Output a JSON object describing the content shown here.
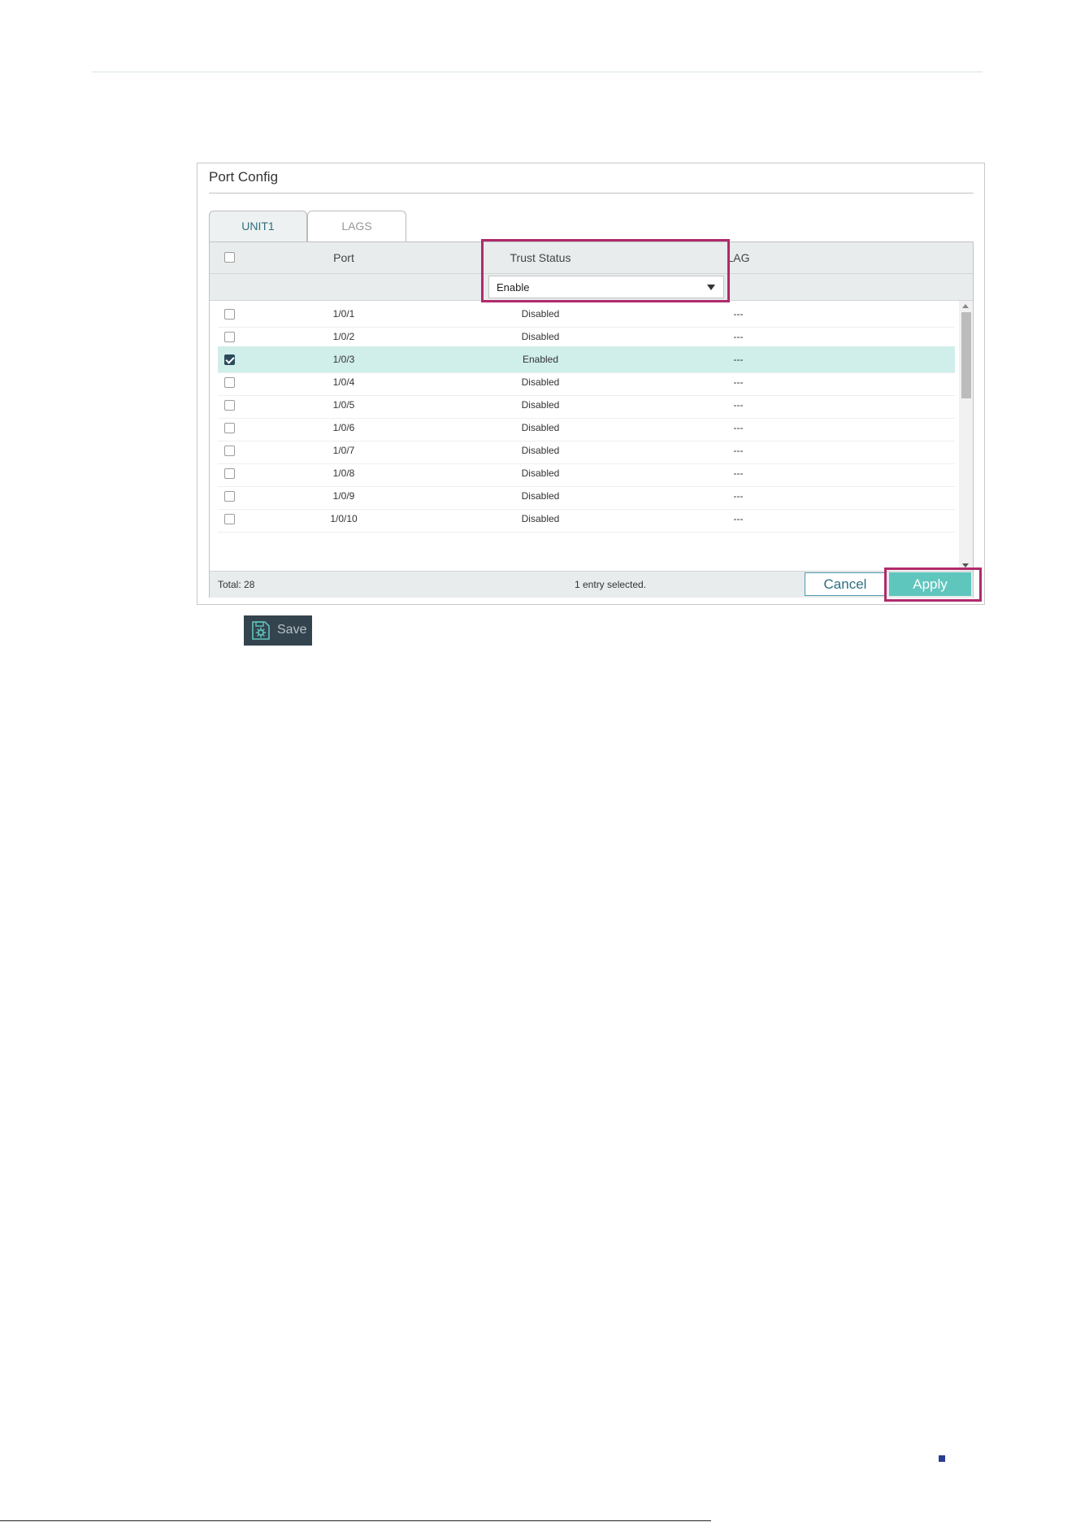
{
  "panel": {
    "title": "Port Config",
    "tabs": [
      {
        "label": "UNIT1",
        "active": true
      },
      {
        "label": "LAGS",
        "active": false
      }
    ]
  },
  "table": {
    "columns": [
      "Port",
      "Trust Status",
      "LAG"
    ],
    "filter": {
      "trust_status_value": "Enable"
    },
    "rows": [
      {
        "port": "1/0/1",
        "trust_status": "Disabled",
        "lag": "---",
        "checked": false
      },
      {
        "port": "1/0/2",
        "trust_status": "Disabled",
        "lag": "---",
        "checked": false
      },
      {
        "port": "1/0/3",
        "trust_status": "Enabled",
        "lag": "---",
        "checked": true
      },
      {
        "port": "1/0/4",
        "trust_status": "Disabled",
        "lag": "---",
        "checked": false
      },
      {
        "port": "1/0/5",
        "trust_status": "Disabled",
        "lag": "---",
        "checked": false
      },
      {
        "port": "1/0/6",
        "trust_status": "Disabled",
        "lag": "---",
        "checked": false
      },
      {
        "port": "1/0/7",
        "trust_status": "Disabled",
        "lag": "---",
        "checked": false
      },
      {
        "port": "1/0/8",
        "trust_status": "Disabled",
        "lag": "---",
        "checked": false
      },
      {
        "port": "1/0/9",
        "trust_status": "Disabled",
        "lag": "---",
        "checked": false
      },
      {
        "port": "1/0/10",
        "trust_status": "Disabled",
        "lag": "---",
        "checked": false
      }
    ],
    "footer": {
      "total": "Total: 28",
      "selected": "1 entry selected.",
      "cancel_label": "Cancel",
      "apply_label": "Apply"
    }
  },
  "save_button": {
    "label": "Save",
    "icon": "save-gear-icon"
  },
  "colors": {
    "accent": "#5fc6bd",
    "highlight": "#b02a6c",
    "selected_row": "#d0eeea",
    "save_bg": "#34444e"
  }
}
